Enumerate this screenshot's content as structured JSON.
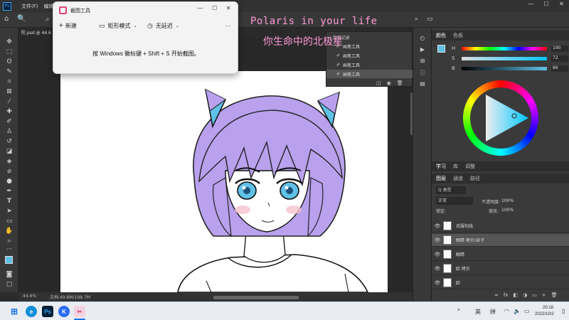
{
  "photoshop": {
    "menu": [
      "文件(F)",
      "编辑"
    ],
    "doc_tab_label": "陀.psd @ 44.6",
    "tab_fragment": "...历史记录",
    "history_items": [
      "画笔工具",
      "画笔工具",
      "画笔工具",
      "画笔工具"
    ],
    "status": {
      "zoom": "44.6%",
      "doc": "文档:49.8M/198.7M"
    },
    "color_panel": {
      "tabs": [
        "颜色",
        "色板"
      ],
      "sliders": [
        {
          "label": "H",
          "value": "190",
          "unit": ""
        },
        {
          "label": "S",
          "value": "72",
          "unit": "%"
        },
        {
          "label": "B",
          "value": "86",
          "unit": "%"
        }
      ],
      "wheel_hue_deg": 190
    },
    "learn_tabs": [
      "学习",
      "库",
      "调整"
    ],
    "layers_panel": {
      "tabs": [
        "图层",
        "通道",
        "路径"
      ],
      "filter_label": "Q 类型",
      "blend_mode": "正常",
      "opacity_label": "不透明度:",
      "opacity_value": "100%",
      "lock_label": "锁定:",
      "fill_label": "填充:",
      "fill_value": "100%",
      "layers": [
        {
          "name": "衣服勾线"
        },
        {
          "name": "眼睛 拷贝(丝子"
        },
        {
          "name": "眼睛"
        },
        {
          "name": "脸 拷贝"
        },
        {
          "name": "脸"
        }
      ],
      "bottom_icons": [
        "∞",
        "fx",
        "◧",
        "◑",
        "▭",
        "+",
        "🗑"
      ]
    }
  },
  "snipping_tool": {
    "title": "截图工具",
    "new_label": "新建",
    "mode_label": "矩形模式",
    "delay_label": "无延迟",
    "more_label": "···",
    "hint": "按 Windows 徽标键 + Shift + S 开始截图。",
    "window_controls": [
      "—",
      "☐",
      "✕"
    ]
  },
  "overlay": {
    "english": "Polaris in your life",
    "chinese": "你生命中的北极星"
  },
  "taskbar": {
    "apps": [
      "⊞",
      "e",
      "Ps",
      "K",
      "✂"
    ],
    "ime_lang": "英",
    "ime_mode": "拼",
    "time": "20:18",
    "date": "2022/10/2",
    "tray_chevron": "^"
  },
  "colors": {
    "accent_blue": "#1473e6",
    "hair_purple": "#b9a1ee",
    "eye_blue": "#5fc1e6",
    "overlay_pink": "#ff9ad8",
    "ps_panel_dark": "#3a3a3a"
  }
}
